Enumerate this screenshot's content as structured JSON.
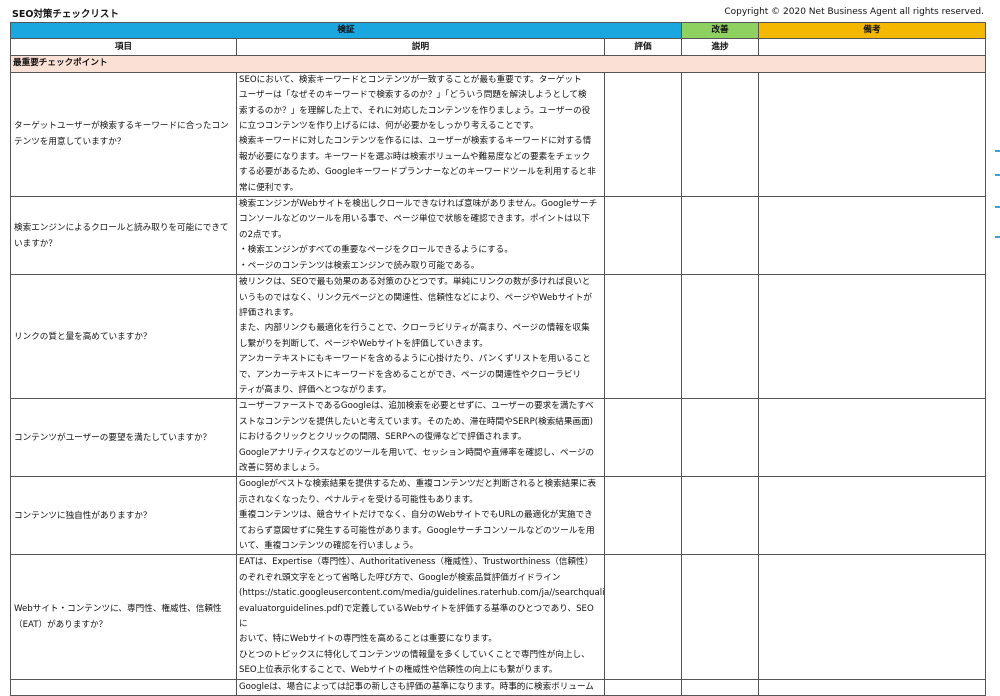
{
  "header": {
    "title": "SEO対策チェックリスト",
    "copyright": "Copyright © 2020 Net Business Agent all rights reserved."
  },
  "table": {
    "groups": {
      "verify": "検証",
      "improve": "改善",
      "note": "備考"
    },
    "columns": {
      "item": "項目",
      "description": "説明",
      "rating": "評価",
      "progress": "進捗"
    },
    "section_title": "最重要チェックポイント",
    "rows": [
      {
        "item": "ターゲットユーザーが検索するキーワードに合ったコンテンツを用意していますか？",
        "description": "SEOにおいて、検索キーワードとコンテンツが一致することが最も重要です。ターゲット\nユーザーは「なぜそのキーワードで検索するのか？」「どういう問題を解決しようとして検\n索するのか？」を理解した上で、それに対応したコンテンツを作りましょう。ユーザーの役\nに立つコンテンツを作り上げるには、何が必要かをしっかり考えることです。\n検索キーワードに対したコンテンツを作るには、ユーザーが検索するキーワードに対する情\n報が必要になります。キーワードを選ぶ時は検索ボリュームや難易度などの要素をチェック\nする必要があるため、Googleキーワードプランナーなどのキーワードツールを利用すると非\n常に便利です。"
      },
      {
        "item": "検索エンジンによるクロールと読み取りを可能にできていますか？",
        "description": "検索エンジンがWebサイトを検出しクロールできなければ意味がありません。Googleサーチ\nコンソールなどのツールを用いる事で、ページ単位で状態を確認できます。ポイントは以下\nの2点です。\n・検索エンジンがすべての重要なページをクロールできるようにする。\n・ページのコンテンツは検索エンジンで読み取り可能である。"
      },
      {
        "item": "リンクの質と量を高めていますか？",
        "description": "被リンクは、SEOで最も効果のある対策のひとつです。単純にリンクの数が多ければ良いと\nいうものではなく、リンク元ページとの関連性、信頼性などにより、ページやWebサイトが\n評価されます。\nまた、内部リンクも最適化を行うことで、クローラビリティが高まり、ページの情報を収集\nし繋がりを判断して、ページやWebサイトを評価していきます。\nアンカーテキストにもキーワードを含めるように心掛けたり、パンくずリストを用いること\nで、アンカーテキストにキーワードを含めることができ、ページの関連性やクローラビリ\nティが高まり、評価へとつながります。"
      },
      {
        "item": "コンテンツがユーザーの要望を満たしていますか？",
        "description": "ユーザーファーストであるGoogleは、追加検索を必要とせずに、ユーザーの要求を満たすベ\nストなコンテンツを提供したいと考えています。そのため、滞在時間やSERP(検索結果画面)\nにおけるクリックとクリックの間隔、SERPへの復帰などで評価されます。\nGoogleアナリティクスなどのツールを用いて、セッション時間や直帰率を確認し、ページの\n改善に努めましょう。"
      },
      {
        "item": "コンテンツに独自性がありますか？",
        "description": "Googleがベストな検索結果を提供するため、重複コンテンツだと判断されると検索結果に表\n示されなくなったり、ペナルティを受ける可能性もあります。\n重複コンテンツは、競合サイトだけでなく、自分のWebサイトでもURLの最適化が実施でき\nておらず意図せずに発生する可能性があります。Googleサーチコンソールなどのツールを用\nいて、重複コンテンツの確認を行いましょう。"
      },
      {
        "item": "Webサイト・コンテンツに、専門性、権威性、信頼性（EAT）がありますか？",
        "description": "EATは、Expertise（専門性）、Authoritativeness（権威性）、Trustworthiness（信頼性）\nのぞれぞれ頭文字をとって省略した呼び方で、Googleが検索品質評価ガイドライン\n(https://static.googleusercontent.com/media/guidelines.raterhub.com/ja//searchquality\nevaluatorguidelines.pdf)で定義しているWebサイトを評価する基準のひとつであり、SEOに\nおいて、特にWebサイトの専門性を高めることは重要になります。\nひとつのトピックスに特化してコンテンツの情報量を多くしていくことで専門性が向上し、\nSEO上位表示化することで、Webサイトの権威性や信頼性の向上にも繋がります。"
      },
      {
        "item": "",
        "description": "Googleは、場合によっては記事の新しさも評価の基準になります。時事的に検索ボリューム"
      }
    ]
  }
}
